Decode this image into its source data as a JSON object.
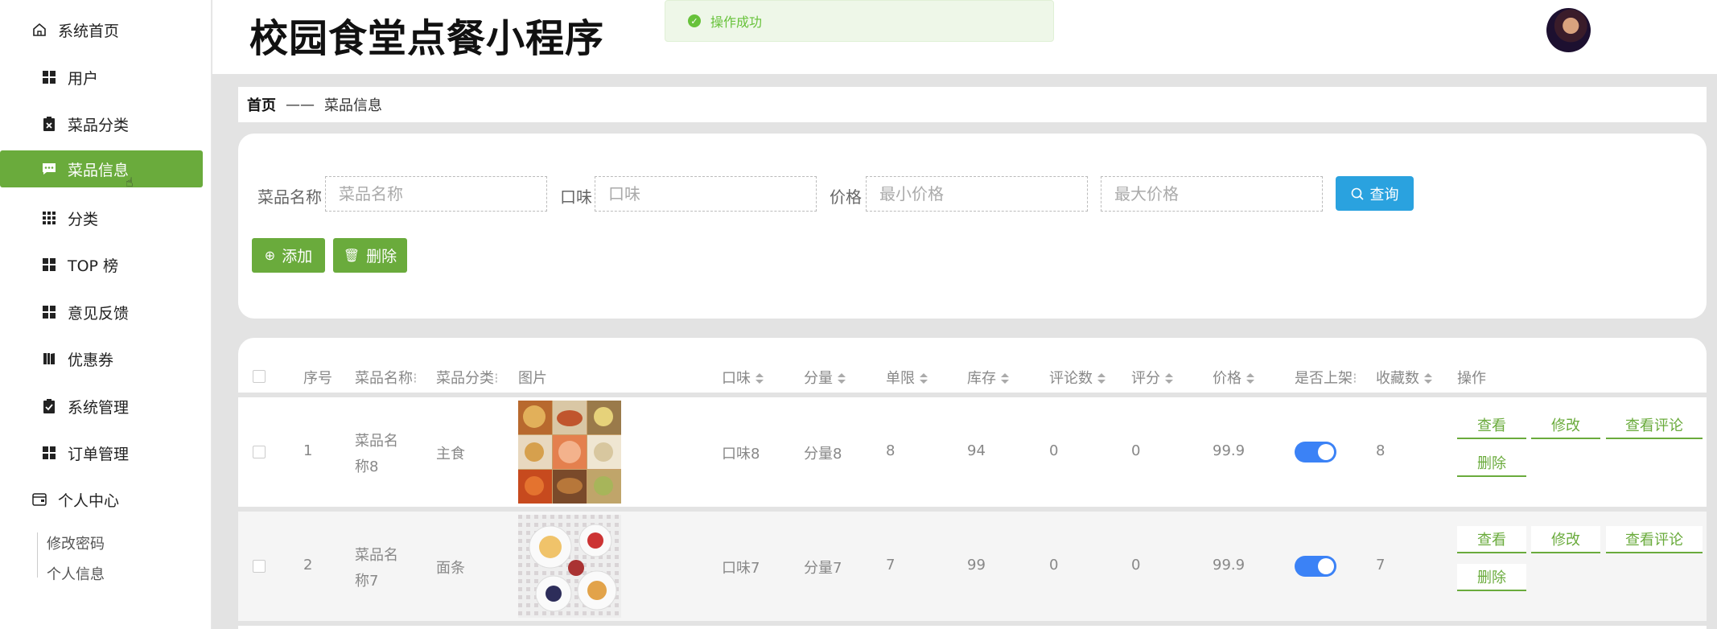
{
  "sidebar": {
    "home": "系统首页",
    "items": [
      {
        "label": "用户",
        "icon": "grid-icon"
      },
      {
        "label": "菜品分类",
        "icon": "clipboard-x-icon"
      },
      {
        "label": "菜品信息",
        "icon": "chat-icon"
      },
      {
        "label": "分类",
        "icon": "grid9-icon"
      },
      {
        "label": "TOP 榜",
        "icon": "grid-icon"
      },
      {
        "label": "意见反馈",
        "icon": "grid-icon"
      },
      {
        "label": "优惠券",
        "icon": "book-icon"
      },
      {
        "label": "系统管理",
        "icon": "clipboard-check-icon"
      },
      {
        "label": "订单管理",
        "icon": "grid-icon"
      }
    ],
    "personal": "个人中心",
    "personal_items": [
      "修改密码",
      "个人信息"
    ]
  },
  "header": {
    "title": "校园食堂点餐小程序",
    "toast": "操作成功"
  },
  "breadcrumb": {
    "home": "首页",
    "sep": "——",
    "current": "菜品信息"
  },
  "search": {
    "name_label": "菜品名称",
    "name_placeholder": "菜品名称",
    "taste_label": "口味",
    "taste_placeholder": "口味",
    "price_label": "价格",
    "min_placeholder": "最小价格",
    "max_placeholder": "最大价格",
    "query_btn": "查询",
    "add_btn": "添加",
    "delete_btn": "删除"
  },
  "table": {
    "headers": {
      "index": "序号",
      "name": "菜品名称",
      "category": "菜品分类",
      "image": "图片",
      "taste": "口味",
      "portion": "分量",
      "limit": "单限",
      "stock": "库存",
      "comments": "评论数",
      "rating": "评分",
      "price": "价格",
      "on_shelf": "是否上架",
      "favorites": "收藏数",
      "actions": "操作"
    },
    "rows": [
      {
        "index": "1",
        "name_l1": "菜品名",
        "name_l2": "称8",
        "category": "主食",
        "taste": "口味8",
        "portion": "分量8",
        "limit": "8",
        "stock": "94",
        "comments": "0",
        "rating": "0",
        "price": "99.9",
        "on_shelf": true,
        "favorites": "8"
      },
      {
        "index": "2",
        "name_l1": "菜品名",
        "name_l2": "称7",
        "category": "面条",
        "taste": "口味7",
        "portion": "分量7",
        "limit": "7",
        "stock": "99",
        "comments": "0",
        "rating": "0",
        "price": "99.9",
        "on_shelf": true,
        "favorites": "7"
      }
    ],
    "actions": {
      "view": "查看",
      "edit": "修改",
      "comments": "查看评论",
      "delete": "删除"
    }
  },
  "colors": {
    "accent": "#6aab3c",
    "query": "#2aa2df",
    "toggle": "#3b82f6",
    "toast": "#67c23a"
  }
}
